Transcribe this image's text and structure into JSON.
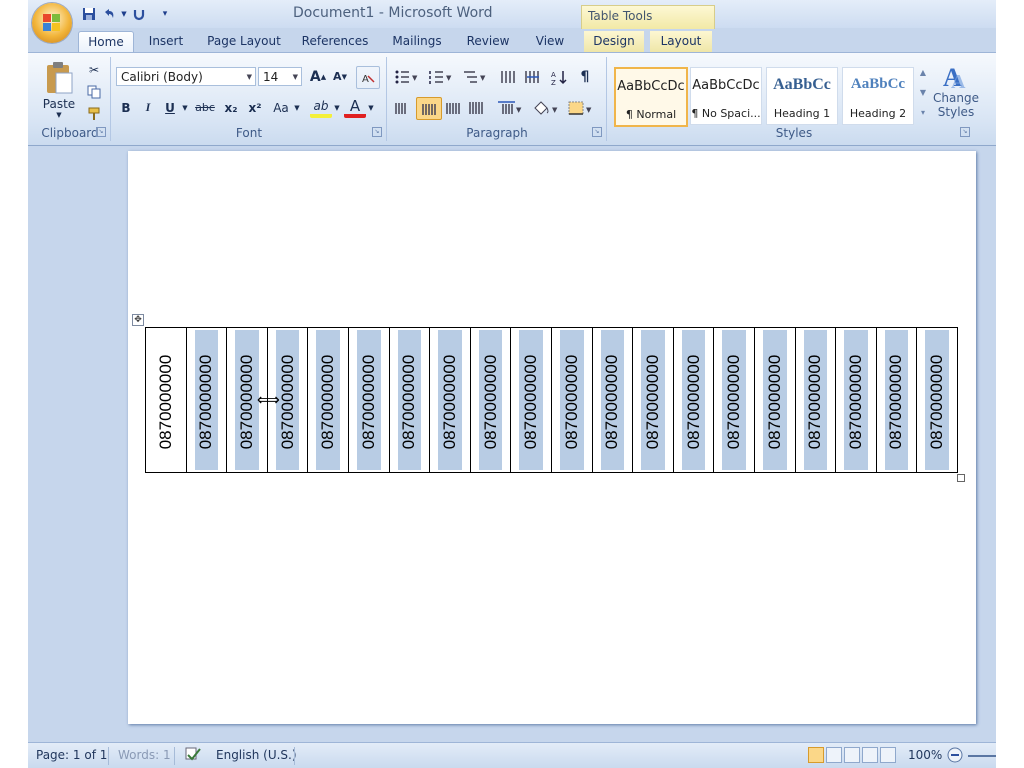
{
  "app": {
    "title": "Document1 - Microsoft Word",
    "contextual_tab_group": "Table Tools"
  },
  "qat": {
    "save_icon": "save-icon",
    "undo_icon": "undo-icon",
    "redo_icon": "repeat-icon",
    "customize_icon": "chevron-down-icon"
  },
  "tabs": [
    {
      "label": "Home",
      "active": true
    },
    {
      "label": "Insert"
    },
    {
      "label": "Page Layout"
    },
    {
      "label": "References"
    },
    {
      "label": "Mailings"
    },
    {
      "label": "Review"
    },
    {
      "label": "View"
    },
    {
      "label": "Design"
    },
    {
      "label": "Layout"
    }
  ],
  "ribbon": {
    "clipboard": {
      "label": "Clipboard",
      "paste": "Paste"
    },
    "font": {
      "label": "Font",
      "font_name": "Calibri (Body)",
      "font_size": "14",
      "grow": "A",
      "shrink": "A",
      "bold": "B",
      "italic": "I",
      "underline": "U",
      "strike": "abc",
      "subscript": "x₂",
      "superscript": "x²",
      "case": "Aa",
      "highlight": "ab",
      "font_color": "A"
    },
    "paragraph": {
      "label": "Paragraph",
      "show_marks": "¶"
    },
    "styles": {
      "label": "Styles",
      "items": [
        {
          "preview": "AaBbCcDc",
          "name": "¶ Normal",
          "selected": true
        },
        {
          "preview": "AaBbCcDc",
          "name": "¶ No Spaci..."
        },
        {
          "preview": "AaBbCc",
          "name": "Heading 1"
        },
        {
          "preview": "AaBbCc",
          "name": "Heading 2"
        }
      ],
      "change_styles_line1": "Change",
      "change_styles_line2": "Styles"
    }
  },
  "table": {
    "cells": [
      "0870000000",
      "0870000000",
      "0870000000",
      "0870000000",
      "0870000000",
      "0870000000",
      "0870000000",
      "0870000000",
      "0870000000",
      "0870000000",
      "0870000000",
      "0870000000",
      "0870000000",
      "0870000000",
      "0870000000",
      "0870000000",
      "0870000000",
      "0870000000",
      "0870000000",
      "0870000000"
    ]
  },
  "status": {
    "page": "Page: 1 of 1",
    "words": "Words: 1",
    "language": "English (U.S.)",
    "zoom": "100%"
  },
  "colors": {
    "selection_shade": "#b8cce4",
    "ribbon_bg": "#dae6f5",
    "frame_bg": "#c6d6ec"
  }
}
